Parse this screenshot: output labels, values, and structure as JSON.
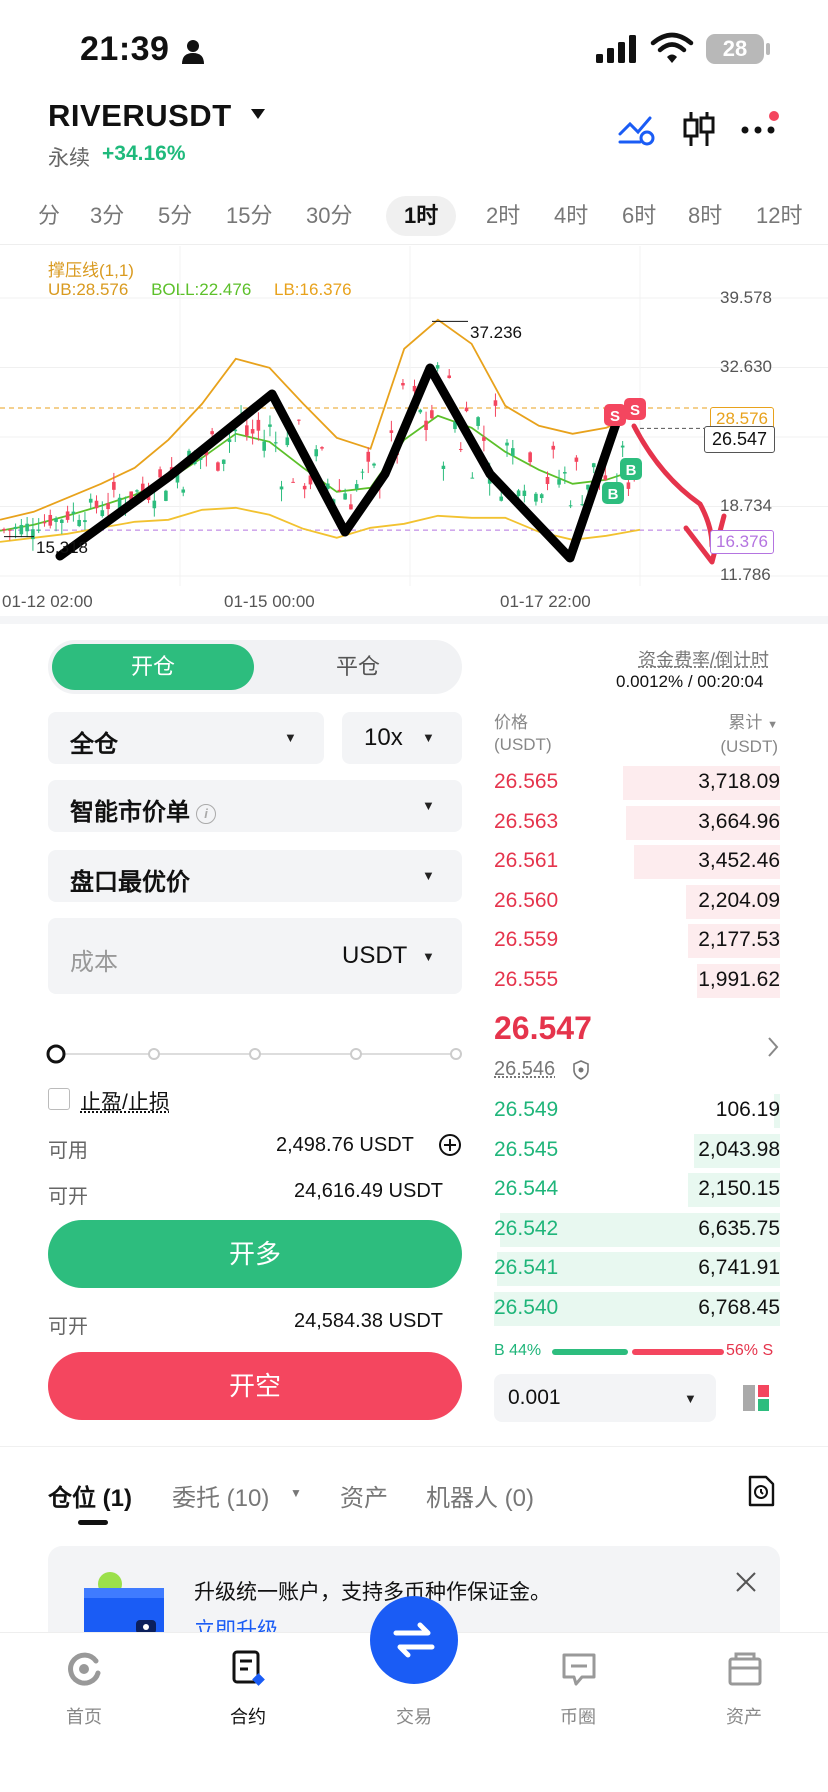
{
  "status_bar": {
    "time": "21:39",
    "battery": "28"
  },
  "header": {
    "symbol": "RIVERUSDT",
    "contract_type": "永续",
    "change_pct": "+34.16%"
  },
  "timeframes": {
    "items": [
      "分",
      "3分",
      "5分",
      "15分",
      "30分",
      "1时",
      "2时",
      "4时",
      "6时",
      "8时",
      "12时"
    ],
    "active": "1时"
  },
  "chart": {
    "indicator_name": "撑压线(1,1)",
    "ub": "UB:28.576",
    "boll": "BOLL:22.476",
    "lb": "LB:16.376",
    "y_labels": [
      "39.578",
      "32.630",
      "28.576",
      "26.547",
      "18.734",
      "16.376",
      "11.786"
    ],
    "x_labels": [
      "01-12 02:00",
      "01-15 00:00",
      "01-17 22:00"
    ],
    "high_marker": "37.236",
    "low_marker": "15.318",
    "signal_s": "S",
    "signal_b": "B"
  },
  "chart_data": {
    "type": "line",
    "series": [
      {
        "name": "UB",
        "values": [
          17.4,
          18.2,
          19.6,
          21.0,
          22.6,
          25.4,
          29.0,
          33.5,
          32.6,
          29.0,
          25.6,
          24.5,
          34.5,
          37.4,
          35.0,
          28.8,
          26.8,
          26.0,
          26.6,
          28.2
        ]
      },
      {
        "name": "BOLL",
        "values": [
          16.3,
          16.9,
          17.8,
          18.8,
          19.9,
          21.4,
          23.6,
          26.0,
          25.2,
          22.6,
          20.2,
          20.6,
          25.4,
          27.8,
          26.6,
          24.2,
          22.4,
          21.0,
          21.4,
          22.5
        ]
      },
      {
        "name": "LB",
        "values": [
          15.2,
          15.6,
          16.0,
          16.6,
          17.2,
          17.4,
          18.4,
          18.6,
          17.9,
          16.5,
          15.6,
          16.6,
          17.0,
          17.8,
          17.6,
          17.6,
          16.2,
          15.4,
          15.8,
          16.4
        ]
      }
    ],
    "ylim": [
      11.786,
      39.578
    ],
    "x_ticks": [
      "01-12 02:00",
      "01-15 00:00",
      "01-17 22:00"
    ],
    "high": 37.236,
    "low": 15.318,
    "last": 26.547
  },
  "order_form": {
    "open_tab": "开仓",
    "close_tab": "平仓",
    "margin_mode": "全仓",
    "leverage": "10x",
    "order_type": "智能市价单",
    "price_type": "盘口最优价",
    "cost_placeholder": "成本",
    "cost_unit": "USDT",
    "tp_sl": "止盈/止损",
    "available_label": "可用",
    "available_value": "2,498.76 USDT",
    "open_long_label": "可开",
    "open_long_value": "24,616.49 USDT",
    "long_button": "开多",
    "open_short_label": "可开",
    "open_short_value": "24,584.38 USDT",
    "short_button": "开空"
  },
  "funding": {
    "label": "资金费率/倒计时",
    "value": "0.0012% / 00:20:04"
  },
  "order_book": {
    "price_header": "价格",
    "price_unit": "(USDT)",
    "total_header": "累计",
    "total_unit": "(USDT)",
    "asks": [
      {
        "price": "26.565",
        "total": "3,718.09",
        "depth": 0.55
      },
      {
        "price": "26.563",
        "total": "3,664.96",
        "depth": 0.54
      },
      {
        "price": "26.561",
        "total": "3,452.46",
        "depth": 0.51
      },
      {
        "price": "26.560",
        "total": "2,204.09",
        "depth": 0.33
      },
      {
        "price": "26.559",
        "total": "2,177.53",
        "depth": 0.32
      },
      {
        "price": "26.555",
        "total": "1,991.62",
        "depth": 0.29
      }
    ],
    "last_price": "26.547",
    "mark_price": "26.546",
    "bids": [
      {
        "price": "26.549",
        "total": "106.19",
        "depth": 0.02
      },
      {
        "price": "26.545",
        "total": "2,043.98",
        "depth": 0.3
      },
      {
        "price": "26.544",
        "total": "2,150.15",
        "depth": 0.32
      },
      {
        "price": "26.542",
        "total": "6,635.75",
        "depth": 0.98
      },
      {
        "price": "26.541",
        "total": "6,741.91",
        "depth": 0.99
      },
      {
        "price": "26.540",
        "total": "6,768.45",
        "depth": 1.0
      }
    ],
    "buy_ratio": "B 44%",
    "sell_ratio": "56% S",
    "buy_ratio_value": 0.44,
    "precision": "0.001"
  },
  "positions": {
    "tabs": [
      "仓位 (1)",
      "委托 (10)",
      "资产",
      "机器人 (0)"
    ]
  },
  "banner": {
    "text": "升级统一账户，支持多币种作保证金。",
    "link": "立即升级"
  },
  "nav": {
    "items": [
      "首页",
      "合约",
      "交易",
      "币圈",
      "资产"
    ]
  },
  "colors": {
    "green": "#2dbd7e",
    "red": "#f4465f",
    "fab_blue": "#1a5cf5"
  }
}
